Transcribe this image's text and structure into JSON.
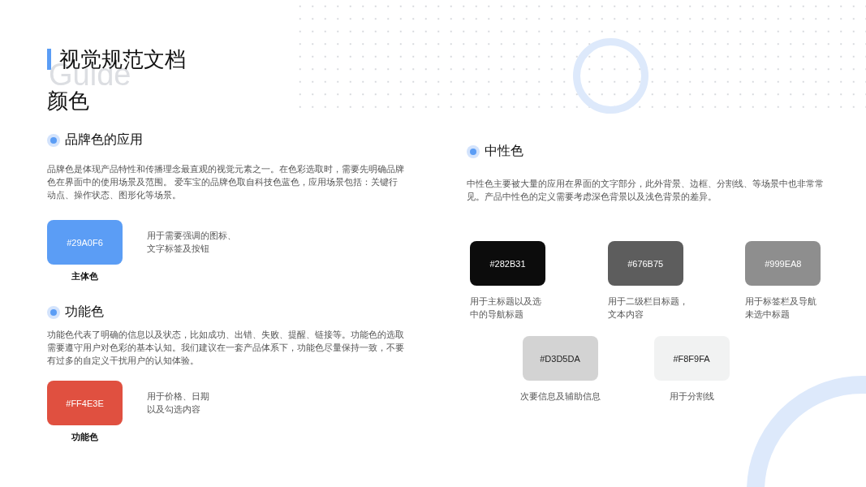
{
  "title": "视觉规范文档",
  "title_background_text": "Guide",
  "page_heading": "颜色",
  "brand": {
    "heading": "品牌色的应用",
    "description": "品牌色是体现产品特性和传播理念最直观的视觉元素之一。在色彩选取时，需要先明确品牌色在界面中的使用场景及范围。 爱车宝的品牌色取自科技色蓝色，应用场景包括：关键行动点、操作状态、图形化等场景。",
    "swatch": {
      "hex": "#29A0F6",
      "color": "#5b9df5",
      "name": "主体色",
      "usage": [
        "用于需要强调的图标、",
        "文字标签及按钮"
      ]
    }
  },
  "functional": {
    "heading": "功能色",
    "description": "功能色代表了明确的信息以及状态，比如成功、出错、失败、提醒、链接等。功能色的选取需要遵守用户对色彩的基本认知。我们建议在一套产品体系下，功能色尽量保持一致，不要有过多的自定义干扰用户的认知体验。",
    "swatch": {
      "hex": "#FF4E3E",
      "color": "#e05040",
      "name": "功能色",
      "usage": [
        "用于价格、日期",
        "以及勾选内容"
      ]
    }
  },
  "neutral": {
    "heading": "中性色",
    "description": "中性色主要被大量的应用在界面的文字部分，此外背景、边框、分割线、等场景中也非常常见。产品中性色的定义需要考虑深色背景以及浅色背景的差异。",
    "swatches": [
      {
        "hex": "#282B31",
        "color": "#0c0c0c",
        "usage": [
          "用于主标题以及选",
          "中的导航标题"
        ]
      },
      {
        "hex": "#676B75",
        "color": "#5d5d5d",
        "usage": [
          "用于二级栏目标题，",
          "文本内容"
        ]
      },
      {
        "hex": "#999EA8",
        "color": "#8e8e8e",
        "usage": [
          "用于标签栏及导航",
          "未选中标题"
        ]
      },
      {
        "hex": "#D3D5DA",
        "color": "#d3d3d3",
        "usage": [
          "次要信息及辅助信息"
        ]
      },
      {
        "hex": "#F8F9FA",
        "color": "#f1f2f2",
        "usage": [
          "用于分割线"
        ]
      }
    ]
  }
}
